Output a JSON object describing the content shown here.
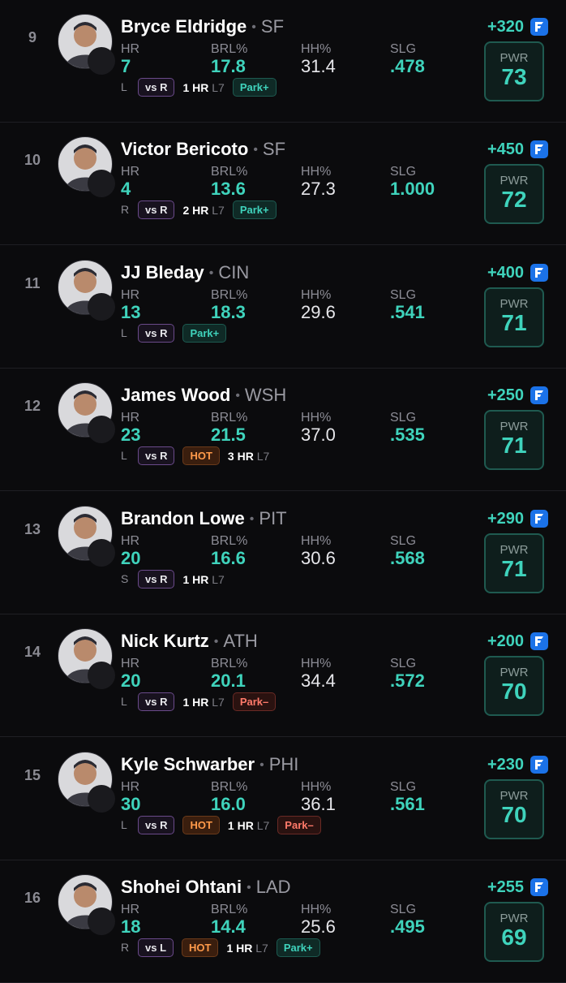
{
  "labels": {
    "hr": "HR",
    "brl": "BRL%",
    "hh": "HH%",
    "slg": "SLG",
    "pwr": "PWR",
    "l7": "L7",
    "hot": "HOT"
  },
  "players": [
    {
      "rank": "9",
      "name": "Bryce Eldridge",
      "team": "SF",
      "hr": "7",
      "brl": "17.8",
      "hh": "31.4",
      "slg": ".478",
      "hand": "L",
      "vs": "vs R",
      "hot": false,
      "l7_hr": "1 HR",
      "park": "Park+",
      "park_type": "plus",
      "odds": "+320",
      "pwr": "73"
    },
    {
      "rank": "10",
      "name": "Victor Bericoto",
      "team": "SF",
      "hr": "4",
      "brl": "13.6",
      "hh": "27.3",
      "slg": "1.000",
      "hand": "R",
      "vs": "vs R",
      "hot": false,
      "l7_hr": "2 HR",
      "park": "Park+",
      "park_type": "plus",
      "odds": "+450",
      "pwr": "72"
    },
    {
      "rank": "11",
      "name": "JJ Bleday",
      "team": "CIN",
      "hr": "13",
      "brl": "18.3",
      "hh": "29.6",
      "slg": ".541",
      "hand": "L",
      "vs": "vs R",
      "hot": false,
      "l7_hr": "",
      "park": "Park+",
      "park_type": "plus",
      "odds": "+400",
      "pwr": "71"
    },
    {
      "rank": "12",
      "name": "James Wood",
      "team": "WSH",
      "hr": "23",
      "brl": "21.5",
      "hh": "37.0",
      "slg": ".535",
      "hand": "L",
      "vs": "vs R",
      "hot": true,
      "l7_hr": "3 HR",
      "park": "",
      "park_type": "",
      "odds": "+250",
      "pwr": "71"
    },
    {
      "rank": "13",
      "name": "Brandon Lowe",
      "team": "PIT",
      "hr": "20",
      "brl": "16.6",
      "hh": "30.6",
      "slg": ".568",
      "hand": "S",
      "vs": "vs R",
      "hot": false,
      "l7_hr": "1 HR",
      "park": "",
      "park_type": "",
      "odds": "+290",
      "pwr": "71"
    },
    {
      "rank": "14",
      "name": "Nick Kurtz",
      "team": "ATH",
      "hr": "20",
      "brl": "20.1",
      "hh": "34.4",
      "slg": ".572",
      "hand": "L",
      "vs": "vs R",
      "hot": false,
      "l7_hr": "1 HR",
      "park": "Park–",
      "park_type": "minus",
      "odds": "+200",
      "pwr": "70"
    },
    {
      "rank": "15",
      "name": "Kyle Schwarber",
      "team": "PHI",
      "hr": "30",
      "brl": "16.0",
      "hh": "36.1",
      "slg": ".561",
      "hand": "L",
      "vs": "vs R",
      "hot": true,
      "l7_hr": "1 HR",
      "park": "Park–",
      "park_type": "minus",
      "odds": "+230",
      "pwr": "70"
    },
    {
      "rank": "16",
      "name": "Shohei Ohtani",
      "team": "LAD",
      "hr": "18",
      "brl": "14.4",
      "hh": "25.6",
      "slg": ".495",
      "hand": "R",
      "vs": "vs L",
      "hot": true,
      "l7_hr": "1 HR",
      "park": "Park+",
      "park_type": "plus",
      "odds": "+255",
      "pwr": "69"
    }
  ],
  "colors": {
    "accent": "#3fd3bc",
    "background": "#0b0b0d",
    "book_icon": "#1b72e8",
    "hot": "#ff9a4a",
    "park_minus": "#ff7a6a"
  },
  "icons": {
    "book": "sportsbook-icon",
    "avatar": "player-headshot"
  }
}
